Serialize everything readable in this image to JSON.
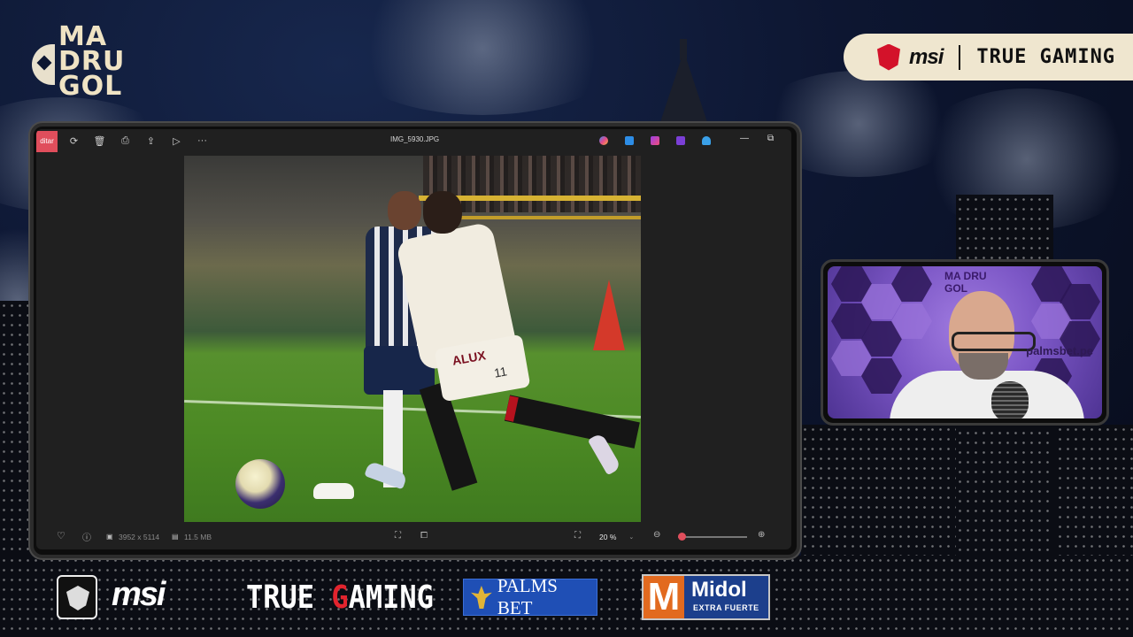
{
  "overlay": {
    "logo_text": "MA DRU GOL",
    "top_sponsor": {
      "brand": "msi",
      "tagline": "TRUE GAMING"
    },
    "bottom_sponsors": {
      "msi": "msi",
      "true_gaming_prefix": "TRUE ",
      "true_gaming_g": "G",
      "true_gaming_suffix": "AMING",
      "palms_bet": "PALMS BET",
      "midol_letter": "M",
      "midol_name": "Midol",
      "midol_sub": "EXTRA FUERTE"
    },
    "webcam": {
      "brand_text": "palmsbet.pe",
      "logo_text": "MA DRU GOL"
    }
  },
  "viewer": {
    "edit_label": "ditar",
    "file_name": "IMG_5930.JPG",
    "toolbar_icons": [
      "rotate-icon",
      "delete-icon",
      "print-icon",
      "share-icon",
      "slideshow-icon",
      "more-icon"
    ],
    "app_icons": [
      "copilot-icon",
      "designer-icon",
      "clipchamp-icon",
      "edit-app-icon",
      "onedrive-icon"
    ],
    "photo": {
      "jersey_text": "ALUX",
      "number": "11"
    },
    "status": {
      "dimensions": "3952 x 5114",
      "size": "11.5 MB",
      "zoom": "20 %",
      "zoom_fraction": 0.05
    }
  },
  "colors": {
    "accent": "#e04e5c",
    "msi_red": "#d3122a",
    "pill_bg": "#efe6cf",
    "palms_blue": "#1f4fb5",
    "midol_orange": "#e26a1f"
  }
}
